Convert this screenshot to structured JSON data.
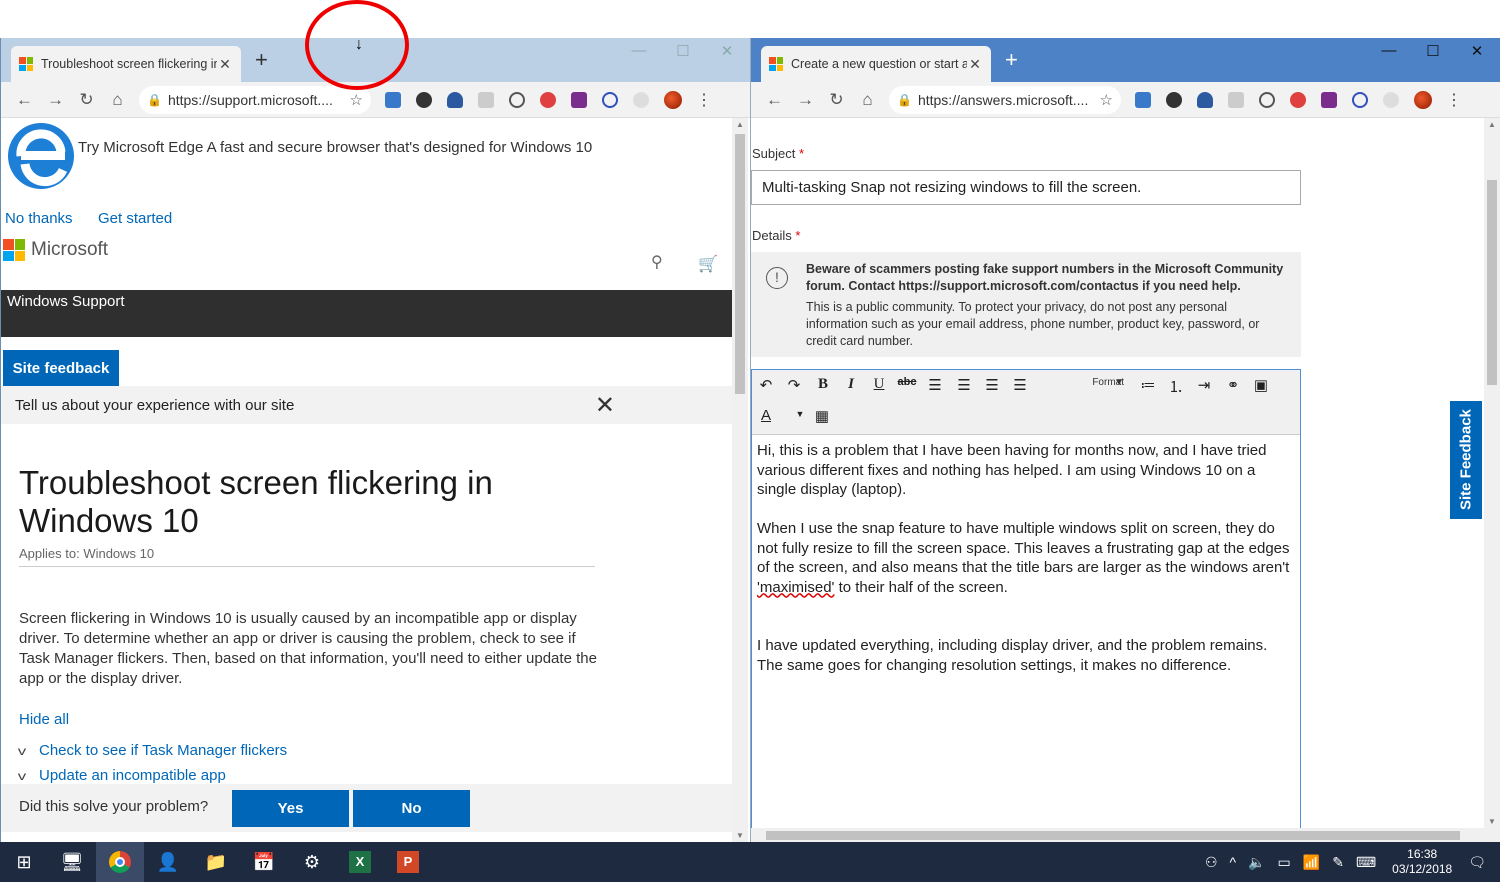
{
  "left": {
    "tab_title": "Troubleshoot screen flickering in",
    "url": "https://support.microsoft....",
    "edge_promo": "Try Microsoft Edge A fast and secure browser that's designed for Windows 10",
    "no_thanks": "No thanks",
    "get_started": "Get started",
    "brand": "Microsoft",
    "nav_title": "Windows Support",
    "site_feedback": "Site feedback",
    "tell_us": "Tell us about your experience with our site",
    "title": "Troubleshoot screen flickering in Windows 10",
    "applies": "Applies to: Windows 10",
    "body": "Screen flickering in Windows 10 is usually caused by an incompatible app or display driver. To determine whether an app or driver is causing the problem, check to see if Task Manager flickers. Then, based on that information, you'll need to either update the app or the display driver.",
    "hide_all": "Hide all",
    "sections": [
      "Check to see if Task Manager flickers",
      "Update an incompatible app"
    ],
    "question": "Did this solve your problem?",
    "yes": "Yes",
    "no": "No"
  },
  "right": {
    "tab_title": "Create a new question or start a",
    "url": "https://answers.microsoft....",
    "subject_label": "Subject",
    "subject_value": "Multi-tasking Snap not resizing windows to fill the screen.",
    "details_label": "Details",
    "required_mark": "*",
    "warn_bold": "Beware of scammers posting fake support numbers in the Microsoft Community forum. Contact https://support.microsoft.com/contactus if you need help.",
    "warn_text": "This is a public community. To protect your privacy, do not post any personal information such as your email address, phone number, product key, password, or credit card number.",
    "format_label": "Format",
    "para1": "Hi, this is a problem that I have been having for months now, and I have tried various different fixes and nothing has helped. I am using Windows 10 on a single display (laptop).",
    "para2_a": "When I use the snap feature to have multiple windows split on screen, they do not fully resize to fill the screen space. This leaves a frustrating gap at the edges of the screen, and also means that the title bars are larger as the windows aren't ",
    "para2_b": "'maximised'",
    "para2_c": " to their half of the screen.",
    "para3": "I have updated everything, including display driver, and the problem remains. The same goes for changing resolution settings, it makes no difference.",
    "site_feedback": "Site Feedback"
  },
  "taskbar": {
    "time": "16:38",
    "date": "03/12/2018"
  },
  "colors": {
    "accent": "#0067b8",
    "annotation": "#e00000"
  }
}
